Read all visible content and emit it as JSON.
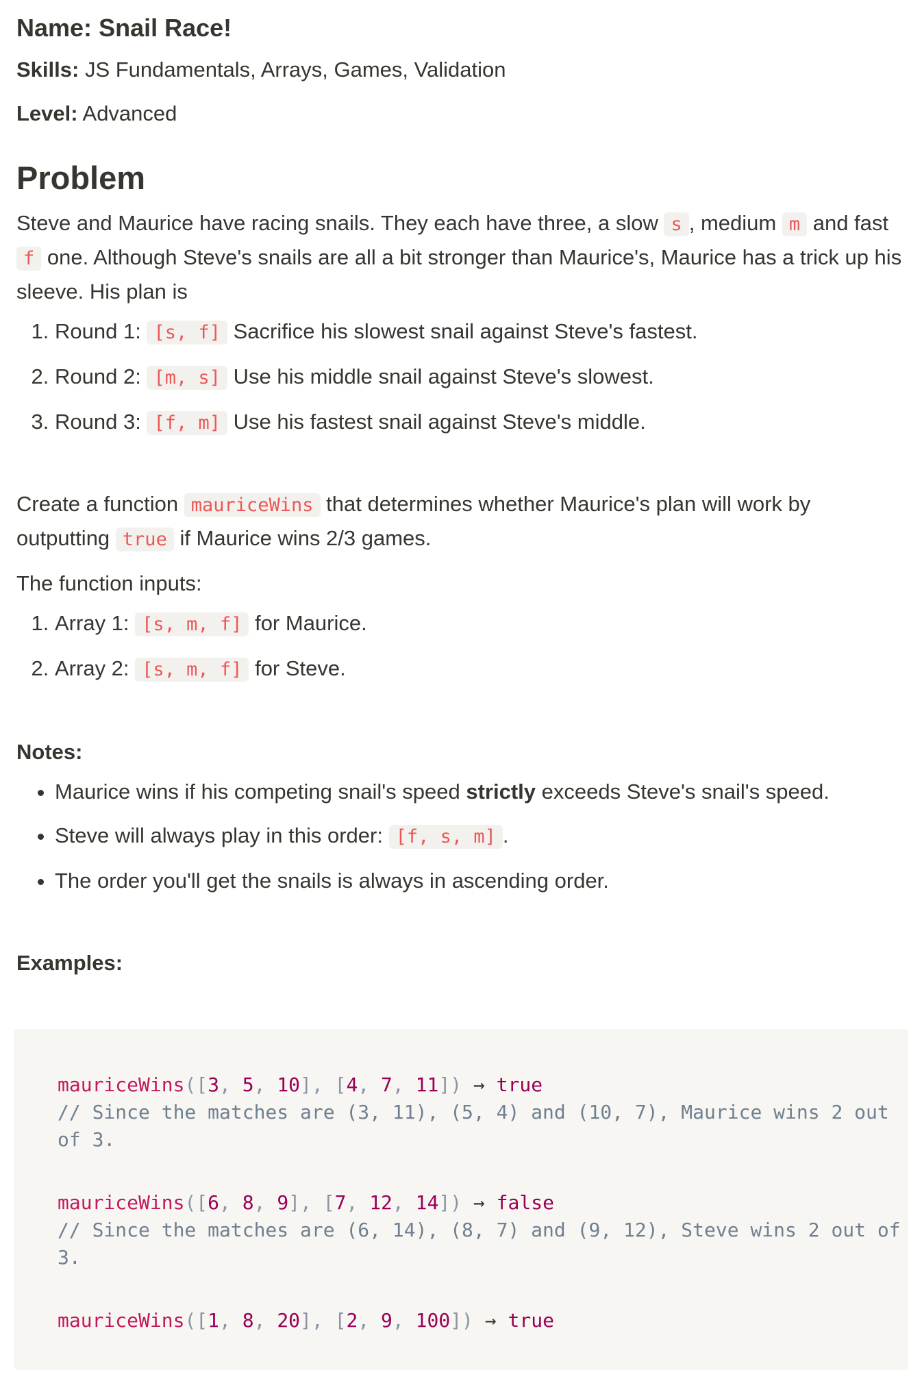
{
  "header": {
    "name_label": "Name:",
    "name_value": "Snail Race!",
    "skills_label": "Skills:",
    "skills_value": "JS Fundamentals, Arrays, Games, Validation",
    "level_label": "Level:",
    "level_value": "Advanced"
  },
  "problem": {
    "heading": "Problem",
    "intro": {
      "t1": "Steve and Maurice have racing snails. They each have three, a slow ",
      "c1": "s",
      "t2": ", medium ",
      "c2": "m",
      "t3": " and fast ",
      "c3": "f",
      "t4": " one. Although Steve's snails are all a bit stronger than Maurice's, Maurice has a trick up his sleeve. His plan is"
    },
    "rounds": [
      {
        "label": "Round 1: ",
        "code": "[s, f]",
        "text": " Sacrifice his slowest snail against Steve's fastest."
      },
      {
        "label": "Round 2: ",
        "code": "[m, s]",
        "text": " Use his middle snail against Steve's slowest."
      },
      {
        "label": "Round 3: ",
        "code": "[f, m]",
        "text": " Use his fastest snail against Steve's middle."
      }
    ],
    "create": {
      "t1": "Create a function ",
      "c1": "mauriceWins",
      "t2": " that determines whether Maurice's plan will work by outputting ",
      "c2": "true",
      "t3": " if Maurice wins 2/3 games."
    },
    "inputs_intro": "The function inputs:",
    "inputs": [
      {
        "label": "Array 1: ",
        "code": "[s, m, f]",
        "text": " for Maurice."
      },
      {
        "label": "Array 2: ",
        "code": "[s, m, f]",
        "text": " for Steve."
      }
    ]
  },
  "notes": {
    "heading": "Notes:",
    "n1": {
      "t1": "Maurice wins if his competing snail's speed ",
      "bold": "strictly",
      "t2": " exceeds Steve's snail's speed."
    },
    "n2": {
      "t1": "Steve will always play in this order: ",
      "code": "[f, s, m]",
      "t2": "."
    },
    "n3": "The order you'll get the snails is always in ascending order."
  },
  "examples": {
    "heading": "Examples:",
    "ex1": {
      "fn": "mauriceWins",
      "o1": "([",
      "a1": "3",
      "a2": "5",
      "a3": "10",
      "m1": "], [",
      "b1": "4",
      "b2": "7",
      "b3": "11",
      "c1": "])",
      "arrow": " → ",
      "result": "true",
      "comment1": "// Since the matches are (3, 11), (5, 4) and (10, 7), Maurice wins 2 out",
      "comment2": "of 3."
    },
    "ex2": {
      "fn": "mauriceWins",
      "o1": "([",
      "a1": "6",
      "a2": "8",
      "a3": "9",
      "m1": "], [",
      "b1": "7",
      "b2": "12",
      "b3": "14",
      "c1": "])",
      "arrow": " → ",
      "result": "false",
      "comment1": "// Since the matches are (6, 14), (8, 7) and (9, 12), Steve wins 2 out of",
      "comment2": "3."
    },
    "ex3": {
      "fn": "mauriceWins",
      "o1": "([",
      "a1": "1",
      "a2": "8",
      "a3": "20",
      "m1": "], [",
      "b1": "2",
      "b2": "9",
      "b3": "100",
      "c1": "])",
      "arrow": " → ",
      "result": "true"
    }
  }
}
